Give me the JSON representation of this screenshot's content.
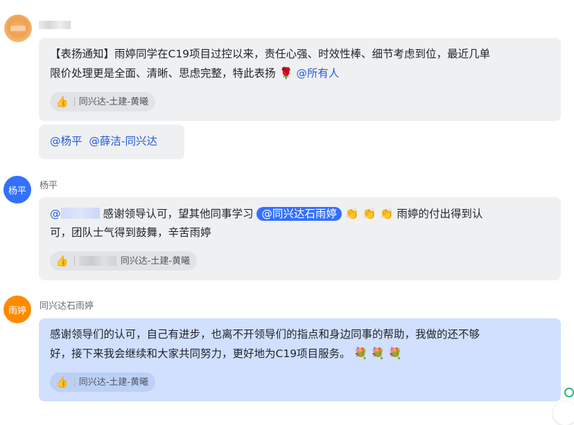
{
  "messages": [
    {
      "sender": "",
      "bubble1": {
        "line1": "【表扬通知】雨婷同学在C19项目过控以来，责任心强、时效性棒、细节考虑到位，最近几单",
        "line2": "限价处理更是全面、清晰、思虑完整，特此表扬",
        "flower": "🌹",
        "mention_all": "@所有人",
        "reaction_user": "同兴达-土建-黄曦"
      },
      "bubble2": {
        "mention1": "@杨平",
        "mention2": "@薛洁-同兴达"
      }
    },
    {
      "sender": "杨平",
      "avatar_text": "杨平",
      "mention_prefix": "@",
      "text1": "感谢领导认可，望其他同事学习",
      "mention_pill": "@同兴达石雨婷",
      "clap": "👏",
      "text2": "雨婷的付出得到认",
      "line2": "可，团队士气得到鼓舞，辛苦雨婷",
      "reaction_user": "同兴达-土建-黄曦"
    },
    {
      "sender": "同兴达石雨婷",
      "avatar_text": "雨婷",
      "line1": "感谢领导们的认可，自己有进步，也离不开领导们的指点和身边同事的帮助，我做的还不够",
      "line2": "好，接下来我会继续和大家共同努力，更好地为C19项目服务。",
      "bouquet": "💐",
      "reaction_user": "同兴达-土建-黄曦"
    }
  ],
  "colors": {
    "mention": "#245bdb",
    "pill": "#3370ff",
    "bubble_gray": "#eff0f1",
    "bubble_blue": "#d1e0ff",
    "avatar_blue": "#3370ff",
    "avatar_orange": "#ff8a00"
  },
  "icons": {
    "reaction": "thumbs-up-icon"
  }
}
